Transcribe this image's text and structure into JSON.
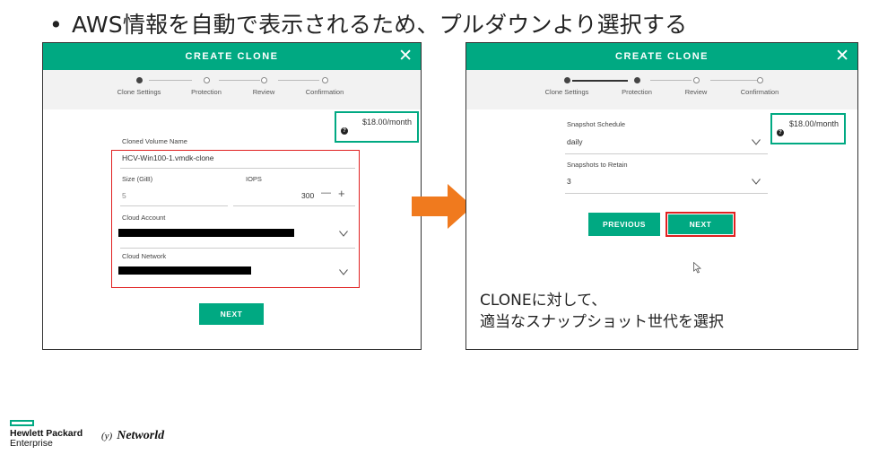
{
  "bullet": {
    "dot": "•",
    "text": "AWS情報を自動で表示されるため、プルダウンより選択する"
  },
  "dialog1": {
    "title": "CREATE CLONE",
    "close": "✕",
    "steps": [
      "Clone Settings",
      "Protection",
      "Review",
      "Confirmation"
    ],
    "active_step": 1,
    "price": "$18.00/month",
    "help": "?",
    "volume_name_label": "Cloned Volume Name",
    "volume_name_value": "HCV-Win100-1.vmdk-clone",
    "size_label": "Size (GiB)",
    "size_value": "5",
    "iops_label": "IOPS",
    "iops_value": "300",
    "iops_minus": "—",
    "iops_plus": "+",
    "cloud_account_label": "Cloud Account",
    "cloud_network_label": "Cloud Network",
    "next_button": "NEXT"
  },
  "dialog2": {
    "title": "CREATE CLONE",
    "close": "✕",
    "steps": [
      "Clone Settings",
      "Protection",
      "Review",
      "Confirmation"
    ],
    "active_step": 2,
    "price": "$18.00/month",
    "help": "?",
    "snapshot_schedule_label": "Snapshot Schedule",
    "snapshot_schedule_value": "daily",
    "snapshots_retain_label": "Snapshots to Retain",
    "snapshots_retain_value": "3",
    "previous_button": "PREVIOUS",
    "next_button": "NEXT"
  },
  "note": {
    "line1": "CLONEに対して、",
    "line2": "適当なスナップショット世代を選択"
  },
  "footer": {
    "hpe_line1": "Hewlett Packard",
    "hpe_line2": "Enterprise",
    "networld": "Networld",
    "networld_mark": "(y)"
  },
  "colors": {
    "accent": "#00a982",
    "highlight": "#e02020",
    "arrow": "#f07a1e"
  }
}
